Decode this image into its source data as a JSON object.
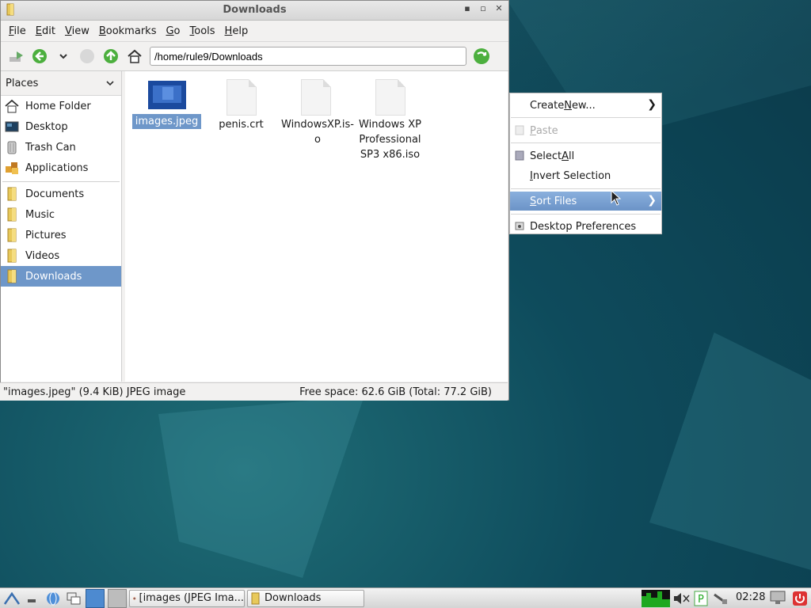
{
  "window": {
    "title": "Downloads",
    "menu": [
      "File",
      "Edit",
      "View",
      "Bookmarks",
      "Go",
      "Tools",
      "Help"
    ],
    "address": "/home/rule9/Downloads"
  },
  "sidebar": {
    "header": "Places",
    "group1": [
      {
        "label": "Home Folder",
        "icon": "home-icon"
      },
      {
        "label": "Desktop",
        "icon": "desktop-icon"
      },
      {
        "label": "Trash Can",
        "icon": "trash-icon"
      },
      {
        "label": "Applications",
        "icon": "applications-icon"
      }
    ],
    "group2": [
      {
        "label": "Documents",
        "icon": "folder-icon"
      },
      {
        "label": "Music",
        "icon": "folder-icon"
      },
      {
        "label": "Pictures",
        "icon": "folder-icon"
      },
      {
        "label": "Videos",
        "icon": "folder-icon"
      },
      {
        "label": "Downloads",
        "icon": "folder-icon",
        "active": true
      }
    ]
  },
  "files": [
    {
      "name": "images.jpeg",
      "selected": true
    },
    {
      "name": "penis.crt"
    },
    {
      "name_line1": "WindowsXP.is-",
      "name_line2": "o"
    },
    {
      "name_line1": "Windows XP",
      "name_line2": "Professional",
      "name_line3": "SP3 x86.iso"
    }
  ],
  "status": {
    "left": "\"images.jpeg\" (9.4 KiB) JPEG image",
    "right": "Free space: 62.6 GiB (Total: 77.2 GiB)"
  },
  "context_menu": {
    "create_new": {
      "pre": "Create ",
      "u": "N",
      "post": "ew..."
    },
    "paste": {
      "pre": "",
      "u": "P",
      "post": "aste"
    },
    "select_all": {
      "pre": "Select ",
      "u": "A",
      "post": "ll"
    },
    "invert": {
      "pre": "",
      "u": "I",
      "post": "nvert Selection"
    },
    "sort": {
      "pre": "",
      "u": "S",
      "post": "ort Files"
    },
    "prefs": "Desktop Preferences"
  },
  "taskbar": {
    "task1": "[images (JPEG Ima...",
    "task2": "Downloads",
    "clock": "02:28"
  },
  "colors": {
    "selection": "#6e97c9",
    "desktop": "#0f4d60"
  }
}
